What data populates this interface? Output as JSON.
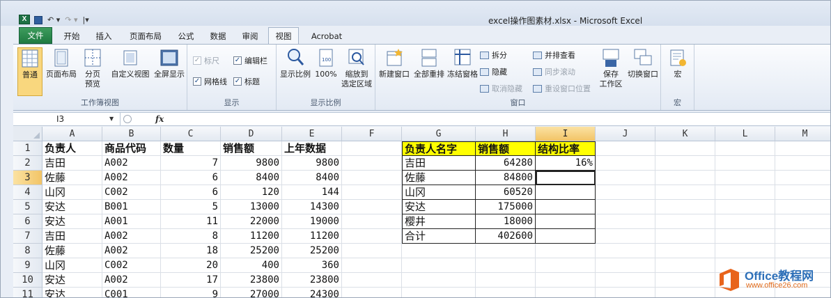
{
  "titlebar": {
    "app_icon": "X",
    "qat": {
      "save_icon": "save-icon",
      "undo": "↶ ▾",
      "redo": "↷ ▾",
      "customize": "|▾"
    },
    "title": "excel操作图素材.xlsx - Microsoft Excel"
  },
  "tabs": [
    {
      "label": "文件"
    },
    {
      "label": "开始"
    },
    {
      "label": "插入"
    },
    {
      "label": "页面布局"
    },
    {
      "label": "公式"
    },
    {
      "label": "数据"
    },
    {
      "label": "审阅"
    },
    {
      "label": "视图"
    },
    {
      "label": "Acrobat"
    }
  ],
  "ribbon": {
    "workbook_views": {
      "label": "工作簿视图",
      "normal": "普通",
      "page_layout": "页面布局",
      "page_break_1": "分页",
      "page_break_2": "预览",
      "custom_views": "自定义视图",
      "full_screen": "全屏显示"
    },
    "show": {
      "label": "显示",
      "ruler": "标尺",
      "formula_bar": "编辑栏",
      "gridlines": "网格线",
      "headings": "标题",
      "check": "✓"
    },
    "zoom": {
      "label": "显示比例",
      "zoom": "显示比例",
      "zoom100": "100%",
      "zoom_sel_1": "缩放到",
      "zoom_sel_2": "选定区域"
    },
    "window": {
      "label": "窗口",
      "new_window": "新建窗口",
      "arrange_all": "全部重排",
      "freeze_panes": "冻结窗格",
      "split": "拆分",
      "hide": "隐藏",
      "unhide": "取消隐藏",
      "side_by_side": "并排查看",
      "sync_scroll": "同步滚动",
      "reset_pos": "重设窗口位置",
      "save_ws_1": "保存",
      "save_ws_2": "工作区",
      "switch": "切换窗口"
    },
    "macros": {
      "label": "宏",
      "macro": "宏"
    }
  },
  "formula_bar": {
    "name_box": "I3",
    "fx": "fx",
    "formula": ""
  },
  "columns": [
    "A",
    "B",
    "C",
    "D",
    "E",
    "F",
    "G",
    "H",
    "I",
    "J",
    "K",
    "L",
    "M"
  ],
  "rows": [
    "1",
    "2",
    "3",
    "4",
    "5",
    "6",
    "7",
    "8",
    "9",
    "10",
    "11"
  ],
  "table": {
    "headers": [
      "负责人",
      "商品代码",
      "数量",
      "销售额",
      "上年数据"
    ],
    "rows": [
      [
        "吉田",
        "A002",
        "7",
        "9800",
        "9800"
      ],
      [
        "佐藤",
        "A002",
        "6",
        "8400",
        "8400"
      ],
      [
        "山冈",
        "C002",
        "6",
        "120",
        "144"
      ],
      [
        "安达",
        "B001",
        "5",
        "13000",
        "14300"
      ],
      [
        "安达",
        "A001",
        "11",
        "22000",
        "19000"
      ],
      [
        "吉田",
        "A002",
        "8",
        "11200",
        "11200"
      ],
      [
        "佐藤",
        "A002",
        "18",
        "25200",
        "25200"
      ],
      [
        "山冈",
        "C002",
        "20",
        "400",
        "360"
      ],
      [
        "安达",
        "A002",
        "17",
        "23800",
        "23800"
      ],
      [
        "安达",
        "C001",
        "9",
        "27000",
        "24300"
      ]
    ]
  },
  "summary": {
    "headers": [
      "负责人名字",
      "销售额",
      "结构比率"
    ],
    "rows": [
      [
        "吉田",
        "64280",
        "16%"
      ],
      [
        "佐藤",
        "84800",
        ""
      ],
      [
        "山冈",
        "60520",
        ""
      ],
      [
        "安达",
        "175000",
        ""
      ],
      [
        "樱井",
        "18000",
        ""
      ],
      [
        "合计",
        "402600",
        ""
      ]
    ]
  },
  "watermark": {
    "line1": "Office教程网",
    "line2": "www.office26.com"
  },
  "colors": {
    "accent_tab": "#1f7a41",
    "header_highlight": "#ffff00",
    "selection": "#f2c466",
    "watermark": "#e06a1a"
  }
}
